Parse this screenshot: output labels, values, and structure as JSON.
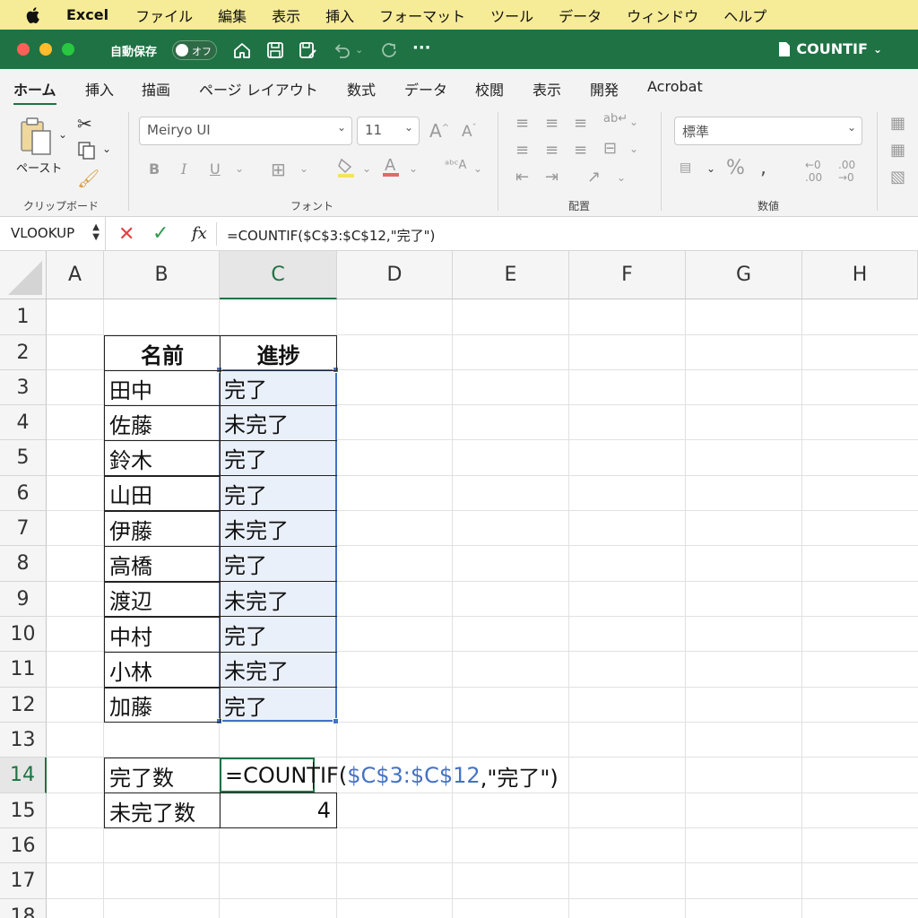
{
  "menubar": {
    "app": "Excel",
    "items": [
      "ファイル",
      "編集",
      "表示",
      "挿入",
      "フォーマット",
      "ツール",
      "データ",
      "ウィンドウ",
      "ヘルプ"
    ]
  },
  "titlebar": {
    "autosave_label": "自動保存",
    "autosave_state": "オフ",
    "document_title": "COUNTIF"
  },
  "ribbon_tabs": [
    "ホーム",
    "挿入",
    "描画",
    "ページ レイアウト",
    "数式",
    "データ",
    "校閲",
    "表示",
    "開発",
    "Acrobat"
  ],
  "ribbon": {
    "clipboard": {
      "paste_label": "ペースト",
      "group_label": "クリップボード"
    },
    "font": {
      "font_name": "Meiryo UI",
      "font_size": "11",
      "group_label": "フォント"
    },
    "alignment": {
      "group_label": "配置"
    },
    "number": {
      "format": "標準",
      "group_label": "数値"
    }
  },
  "formula_bar": {
    "name_box": "VLOOKUP",
    "fx": "fx",
    "formula": "=COUNTIF($C$3:$C$12,\"完了\")"
  },
  "sheet": {
    "columns": [
      "A",
      "B",
      "C",
      "D",
      "E",
      "F",
      "G",
      "H"
    ],
    "rows": [
      "1",
      "2",
      "3",
      "4",
      "5",
      "6",
      "7",
      "8",
      "9",
      "10",
      "11",
      "12",
      "13",
      "14",
      "15",
      "16",
      "17",
      "18"
    ],
    "table_header": {
      "name": "名前",
      "progress": "進捗"
    },
    "records": [
      {
        "name": "田中",
        "progress": "完了"
      },
      {
        "name": "佐藤",
        "progress": "未完了"
      },
      {
        "name": "鈴木",
        "progress": "完了"
      },
      {
        "name": "山田",
        "progress": "完了"
      },
      {
        "name": "伊藤",
        "progress": "未完了"
      },
      {
        "name": "高橋",
        "progress": "完了"
      },
      {
        "name": "渡辺",
        "progress": "未完了"
      },
      {
        "name": "中村",
        "progress": "完了"
      },
      {
        "name": "小林",
        "progress": "未完了"
      },
      {
        "name": "加藤",
        "progress": "完了"
      }
    ],
    "summary": {
      "done_label": "完了数",
      "not_done_label": "未完了数",
      "not_done_value": "4"
    },
    "editing": {
      "prefix": "=COUNTIF(",
      "range": "$C$3:$C$12",
      "suffix": ",\"完了\")"
    }
  },
  "colors": {
    "excel_green": "#1f7244",
    "menubar": "#f6eb97",
    "selection_blue": "#4472c4"
  }
}
